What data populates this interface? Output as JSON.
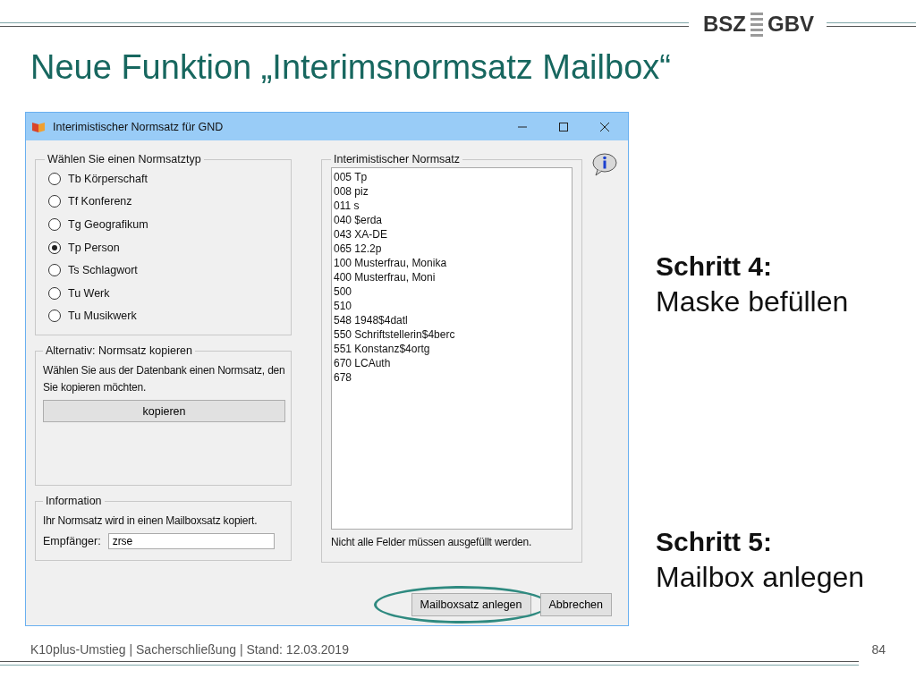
{
  "header": {
    "logo": {
      "left": "BSZ",
      "right": "GBV"
    }
  },
  "slide": {
    "title": "Neue Funktion „Interimsnormsatz Mailbox“"
  },
  "dialog": {
    "window": {
      "title": "Interimistischer Normsatz für GND"
    },
    "type_group": {
      "title": "Wählen Sie einen Normsatztyp",
      "options": [
        {
          "label": "Tb Körperschaft",
          "selected": false
        },
        {
          "label": "Tf Konferenz",
          "selected": false
        },
        {
          "label": "Tg Geografikum",
          "selected": false
        },
        {
          "label": "Tp Person",
          "selected": true
        },
        {
          "label": "Ts Schlagwort",
          "selected": false
        },
        {
          "label": "Tu Werk",
          "selected": false
        },
        {
          "label": "Tu Musikwerk",
          "selected": false
        }
      ]
    },
    "copy_group": {
      "title": "Alternativ: Normsatz kopieren",
      "text": "Wählen Sie aus der Datenbank einen Normsatz, den Sie kopieren möchten.",
      "button": "kopieren"
    },
    "info_group": {
      "title": "Information",
      "text": "Ihr Normsatz wird in einen Mailboxsatz kopiert.",
      "recipient_label": "Empfänger:",
      "recipient_value": "zrse"
    },
    "record_group": {
      "title": "Interimistischer Normsatz",
      "lines": [
        "005 Tp",
        "008 piz",
        "011 s",
        "040 $erda",
        "043 XA-DE",
        "065 12.2p",
        "100 Musterfrau, Monika",
        "400 Musterfrau, Moni",
        "500",
        "510",
        "548 1948$4datl",
        "550 Schriftstellerin$4berc",
        "551 Konstanz$4ortg",
        "670 LCAuth",
        "678"
      ],
      "note": "Nicht alle Felder müssen ausgefüllt werden."
    },
    "buttons": [
      {
        "label": "Mailboxsatz anlegen",
        "highlighted": true
      },
      {
        "label": "Abbrechen",
        "highlighted": false
      }
    ]
  },
  "steps": [
    {
      "title": "Schritt 4:",
      "text": "Maske befüllen"
    },
    {
      "title": "Schritt 5:",
      "text": "Mailbox anlegen"
    }
  ],
  "footer": {
    "text": "K10plus-Umstieg | Sacherschließung | Stand: 12.03.2019",
    "page": "84"
  }
}
